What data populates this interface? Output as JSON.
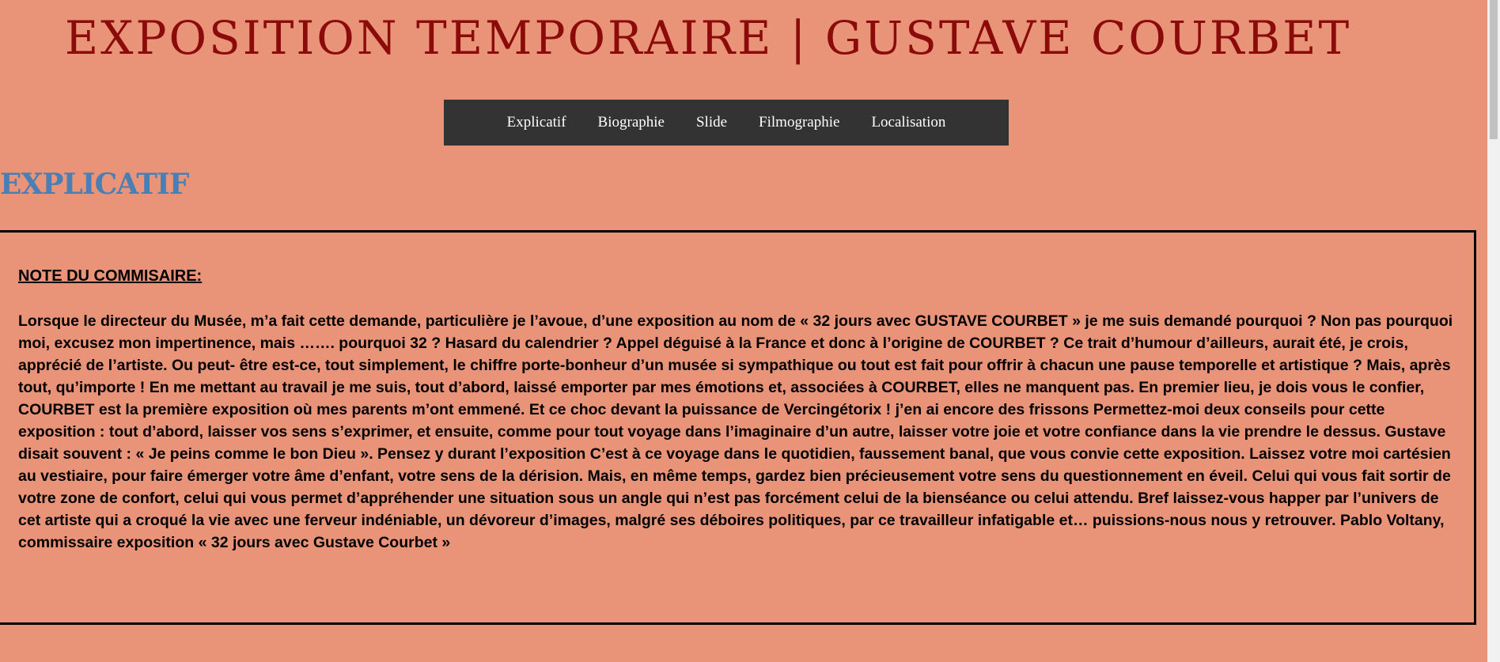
{
  "header": {
    "title": "EXPOSITION TEMPORAIRE | GUSTAVE COURBET"
  },
  "nav": {
    "items": [
      "Explicatif",
      "Biographie",
      "Slide",
      "Filmographie",
      "Localisation"
    ]
  },
  "section": {
    "heading": "EXPLICATIF"
  },
  "note": {
    "title": "NOTE DU COMMISAIRE:",
    "body": "Lorsque le directeur du Musée, m’a fait cette demande, particulière je l’avoue, d’une exposition au nom de « 32 jours avec GUSTAVE COURBET » je me suis demandé pourquoi ? Non pas pourquoi moi, excusez mon impertinence, mais ……. pourquoi 32 ? Hasard du calendrier ? Appel déguisé à la France et donc à l’origine de COURBET ? Ce trait d’humour d’ailleurs, aurait été, je crois, apprécié de l’artiste. Ou peut- être est-ce, tout simplement, le chiffre porte-bonheur d’un musée si sympathique ou tout est fait pour offrir à chacun une pause temporelle et artistique ? Mais, après tout, qu’importe ! En me mettant au travail je me suis, tout d’abord, laissé emporter par mes émotions et, associées à COURBET, elles ne manquent pas. En premier lieu, je dois vous le confier, COURBET est la première exposition où mes parents m’ont emmené. Et ce choc devant la puissance de Vercingétorix ! j’en ai encore des frissons Permettez-moi deux conseils pour cette exposition : tout d’abord, laisser vos sens s’exprimer, et ensuite, comme pour tout voyage dans l’imaginaire d’un autre, laisser votre joie et votre confiance dans la vie prendre le dessus. Gustave disait souvent : « Je peins comme le bon Dieu ». Pensez y durant l’exposition C’est à ce voyage dans le quotidien, faussement banal, que vous convie cette exposition. Laissez votre moi cartésien au vestiaire, pour faire émerger votre âme d’enfant, votre sens de la dérision. Mais, en même temps, gardez bien précieusement votre sens du questionnement en éveil. Celui qui vous fait sortir de votre zone de confort, celui qui vous permet d’appréhender une situation sous un angle qui n’est pas forcément celui de la bienséance ou celui attendu. Bref laissez-vous happer par l’univers de cet artiste qui a croqué la vie avec une ferveur indéniable, un dévoreur d’images, malgré ses déboires politiques, par ce travailleur infatigable et… puissions-nous nous y retrouver. Pablo Voltany, commissaire exposition « 32 jours avec Gustave Courbet »"
  },
  "colors": {
    "background": "#e99379",
    "title": "#8b0a0a",
    "nav_background": "#333333",
    "heading": "#4a7fb5"
  }
}
